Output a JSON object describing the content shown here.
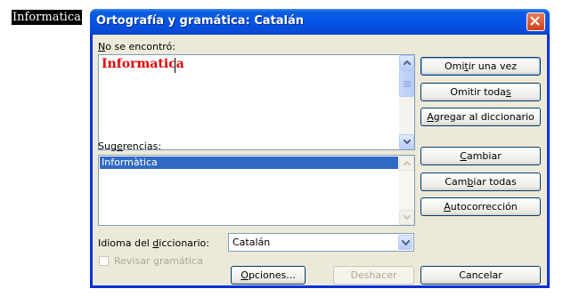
{
  "document": {
    "word": "Informatica"
  },
  "dialog": {
    "title": "Ortografía y gramática: Catalán",
    "not_found_label_accel": "N",
    "not_found_label_rest": "o se encontró:",
    "misspelled_word": "Informatica",
    "suggestions_label_pre": "Sug",
    "suggestions_label_accel": "e",
    "suggestions_label_post": "rencias:",
    "suggestions": [
      "Informàtica"
    ],
    "language_label_pre": "Idioma del ",
    "language_label_accel": "d",
    "language_label_post": "iccionario:",
    "language_value": "Catalán",
    "check_grammar_label": "Revisar gramática",
    "buttons": {
      "ignore_once_pre": "Omi",
      "ignore_once_accel": "t",
      "ignore_once_post": "ir una vez",
      "ignore_all_pre": "Omitir toda",
      "ignore_all_accel": "s",
      "add_pre": "",
      "add_accel": "A",
      "add_post": "gregar al diccionario",
      "change_accel": "C",
      "change_post": "ambiar",
      "change_all_pre": "Cam",
      "change_all_accel": "b",
      "change_all_post": "iar todas",
      "autocorrect_accel": "A",
      "autocorrect_post": "utocorrección",
      "options_accel": "O",
      "options_post": "pciones...",
      "undo": "Deshacer",
      "cancel": "Cancelar"
    }
  }
}
